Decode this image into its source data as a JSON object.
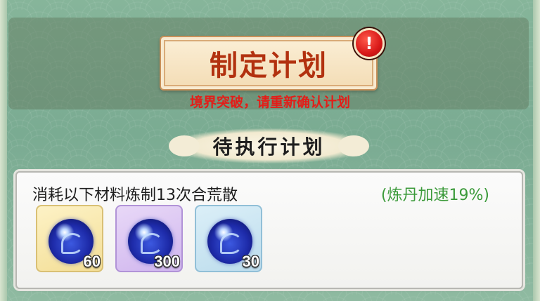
{
  "header": {
    "plan_button_label": "制定计划",
    "alert_badge": "!",
    "warning_text": "境界突破，请重新确认计划"
  },
  "section": {
    "title": "待执行计划"
  },
  "plan": {
    "description": "消耗以下材料炼制13次合荒散",
    "speed_bonus": "(炼丹加速19%)",
    "materials": [
      {
        "slot_color": "yellow",
        "icon": "blue-spirit-orb-icon",
        "quantity": "60"
      },
      {
        "slot_color": "purple",
        "icon": "blue-spirit-orb-icon",
        "quantity": "300"
      },
      {
        "slot_color": "blue",
        "icon": "blue-spirit-orb-icon",
        "quantity": "30"
      }
    ]
  },
  "colors": {
    "button_text": "#b2310f",
    "warning": "#e31d18",
    "speed_bonus": "#3b9a3a"
  }
}
